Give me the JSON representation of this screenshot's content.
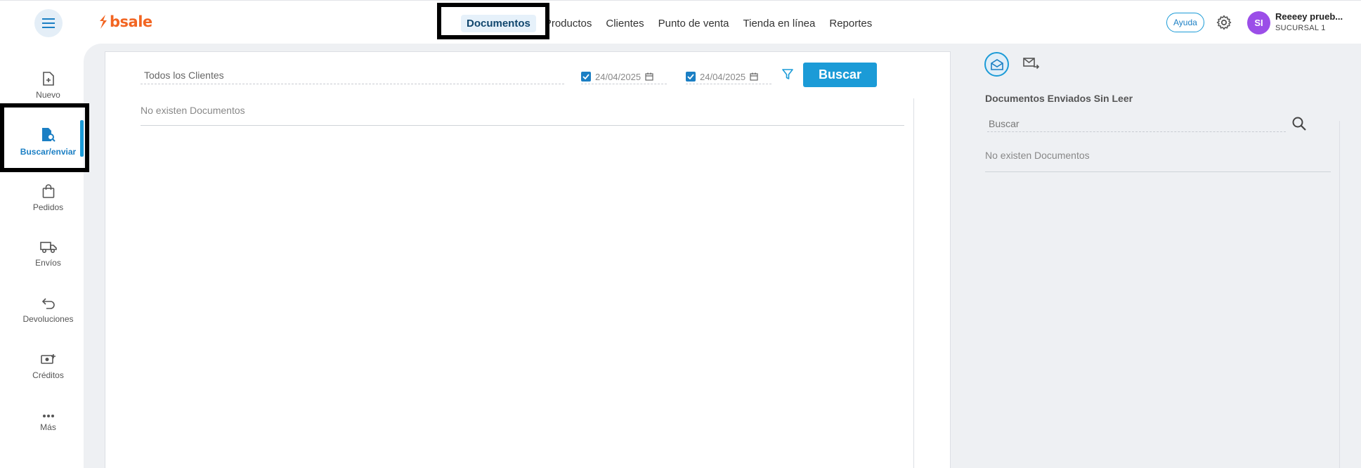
{
  "app": {
    "logo_text": "bsale",
    "brand_color": "#f26522",
    "accent_color": "#1b9bd7"
  },
  "nav": [
    {
      "label": "Documentos",
      "active": true
    },
    {
      "label": "Productos"
    },
    {
      "label": "Clientes"
    },
    {
      "label": "Punto de venta"
    },
    {
      "label": "Tienda en línea"
    },
    {
      "label": "Reportes"
    }
  ],
  "header": {
    "help_label": "Ayuda",
    "avatar_initials": "SI",
    "user_name": "Reeeey prueb...",
    "branch": "SUCURSAL 1"
  },
  "sidebar": [
    {
      "label": "Nuevo",
      "icon": "new-document-icon"
    },
    {
      "label": "Buscar/enviar",
      "icon": "search-document-icon",
      "active": true
    },
    {
      "label": "Pedidos",
      "icon": "shopping-bag-icon"
    },
    {
      "label": "Envíos",
      "icon": "truck-icon"
    },
    {
      "label": "Devoluciones",
      "icon": "return-arrow-icon"
    },
    {
      "label": "Créditos",
      "icon": "money-plus-icon"
    },
    {
      "label": "Más",
      "icon": "more-dots-icon"
    }
  ],
  "search": {
    "client_value": "Todos los Clientes",
    "date_from": "24/04/2025",
    "date_to": "24/04/2025",
    "search_button": "Buscar",
    "empty_message": "No existen Documentos"
  },
  "right_panel": {
    "title": "Documentos Enviados Sin Leer",
    "search_placeholder": "Buscar",
    "empty_message": "No existen Documentos"
  }
}
